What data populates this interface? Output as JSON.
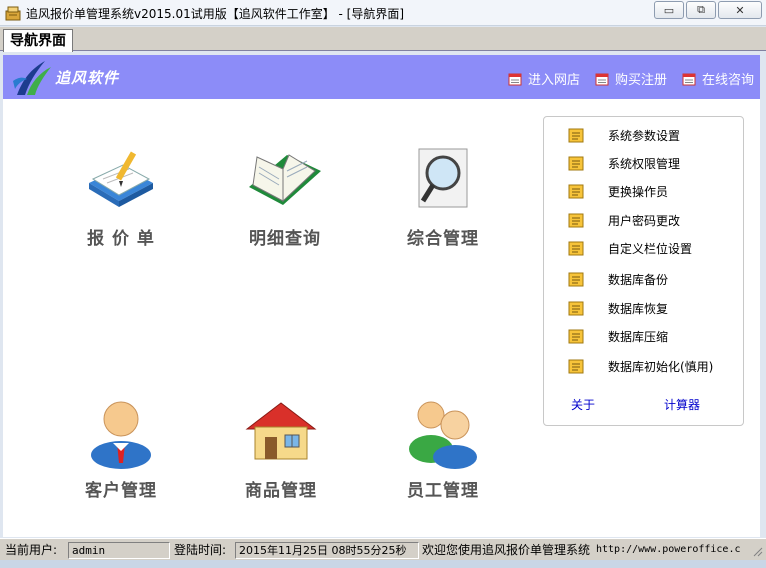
{
  "window": {
    "title": "追风报价单管理系统v2015.01试用版【追风软件工作室】 - [导航界面]",
    "minimize_glyph": "▭",
    "restore_glyph": "⧉",
    "close_glyph": "✕"
  },
  "tabs": [
    {
      "label": "导航界面"
    }
  ],
  "header": {
    "logo_text": "追风软件",
    "links": [
      {
        "label": "进入网店",
        "icon": "calendar-icon"
      },
      {
        "label": "购买注册",
        "icon": "calendar-icon"
      },
      {
        "label": "在线咨询",
        "icon": "calendar-icon"
      }
    ]
  },
  "modules": [
    {
      "label": "报 价 单",
      "icon": "quote-document-icon"
    },
    {
      "label": "明细查询",
      "icon": "open-book-icon"
    },
    {
      "label": "综合管理",
      "icon": "magnifier-icon"
    },
    {
      "label": "客户管理",
      "icon": "customer-icon"
    },
    {
      "label": "商品管理",
      "icon": "house-icon"
    },
    {
      "label": "员工管理",
      "icon": "employees-icon"
    }
  ],
  "side_menu": {
    "items": [
      {
        "label": "系统参数设置"
      },
      {
        "label": "系统权限管理"
      },
      {
        "label": "更换操作员"
      },
      {
        "label": "用户密码更改"
      },
      {
        "label": "自定义栏位设置"
      },
      {
        "label": "数据库备份"
      },
      {
        "label": "数据库恢复"
      },
      {
        "label": "数据库压缩"
      },
      {
        "label": "数据库初始化(慎用)"
      }
    ],
    "about_label": "关于",
    "calculator_label": "计算器"
  },
  "status": {
    "user_label": "当前用户:",
    "user_value": "admin",
    "login_label": "登陆时间:",
    "login_value": "2015年11月25日 08时55分25秒",
    "welcome": "欢迎您使用追风报价单管理系统",
    "url": "http://www.poweroffice.c"
  },
  "colors": {
    "header_bg": "#8c8cf8",
    "link_blue": "#0000cc"
  }
}
